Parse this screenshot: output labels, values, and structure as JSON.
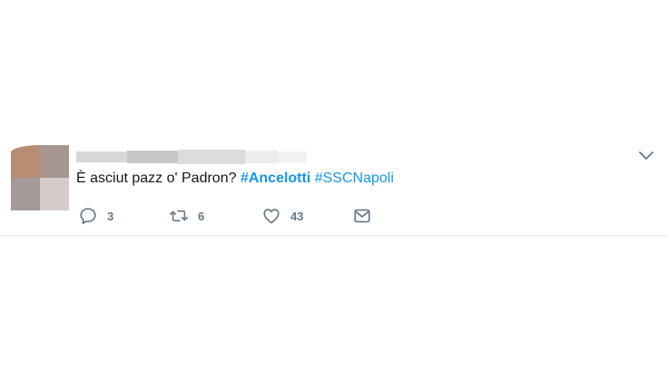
{
  "tweet": {
    "text_plain": "È asciut pazz o' Padron? ",
    "hashtag_1": "#Ancelotti",
    "separator": " ",
    "hashtag_2": "#SSCNapoli",
    "reply_count": "3",
    "retweet_count": "6",
    "like_count": "43"
  },
  "icons": {
    "reply": "reply-bubble-icon",
    "retweet": "retweet-icon",
    "like": "heart-icon",
    "dm": "envelope-icon",
    "menu": "chevron-down-icon"
  },
  "colors": {
    "text": "#14171a",
    "hashtag": "#1b95e0",
    "muted": "#657786",
    "divider": "#e6ecf0"
  }
}
